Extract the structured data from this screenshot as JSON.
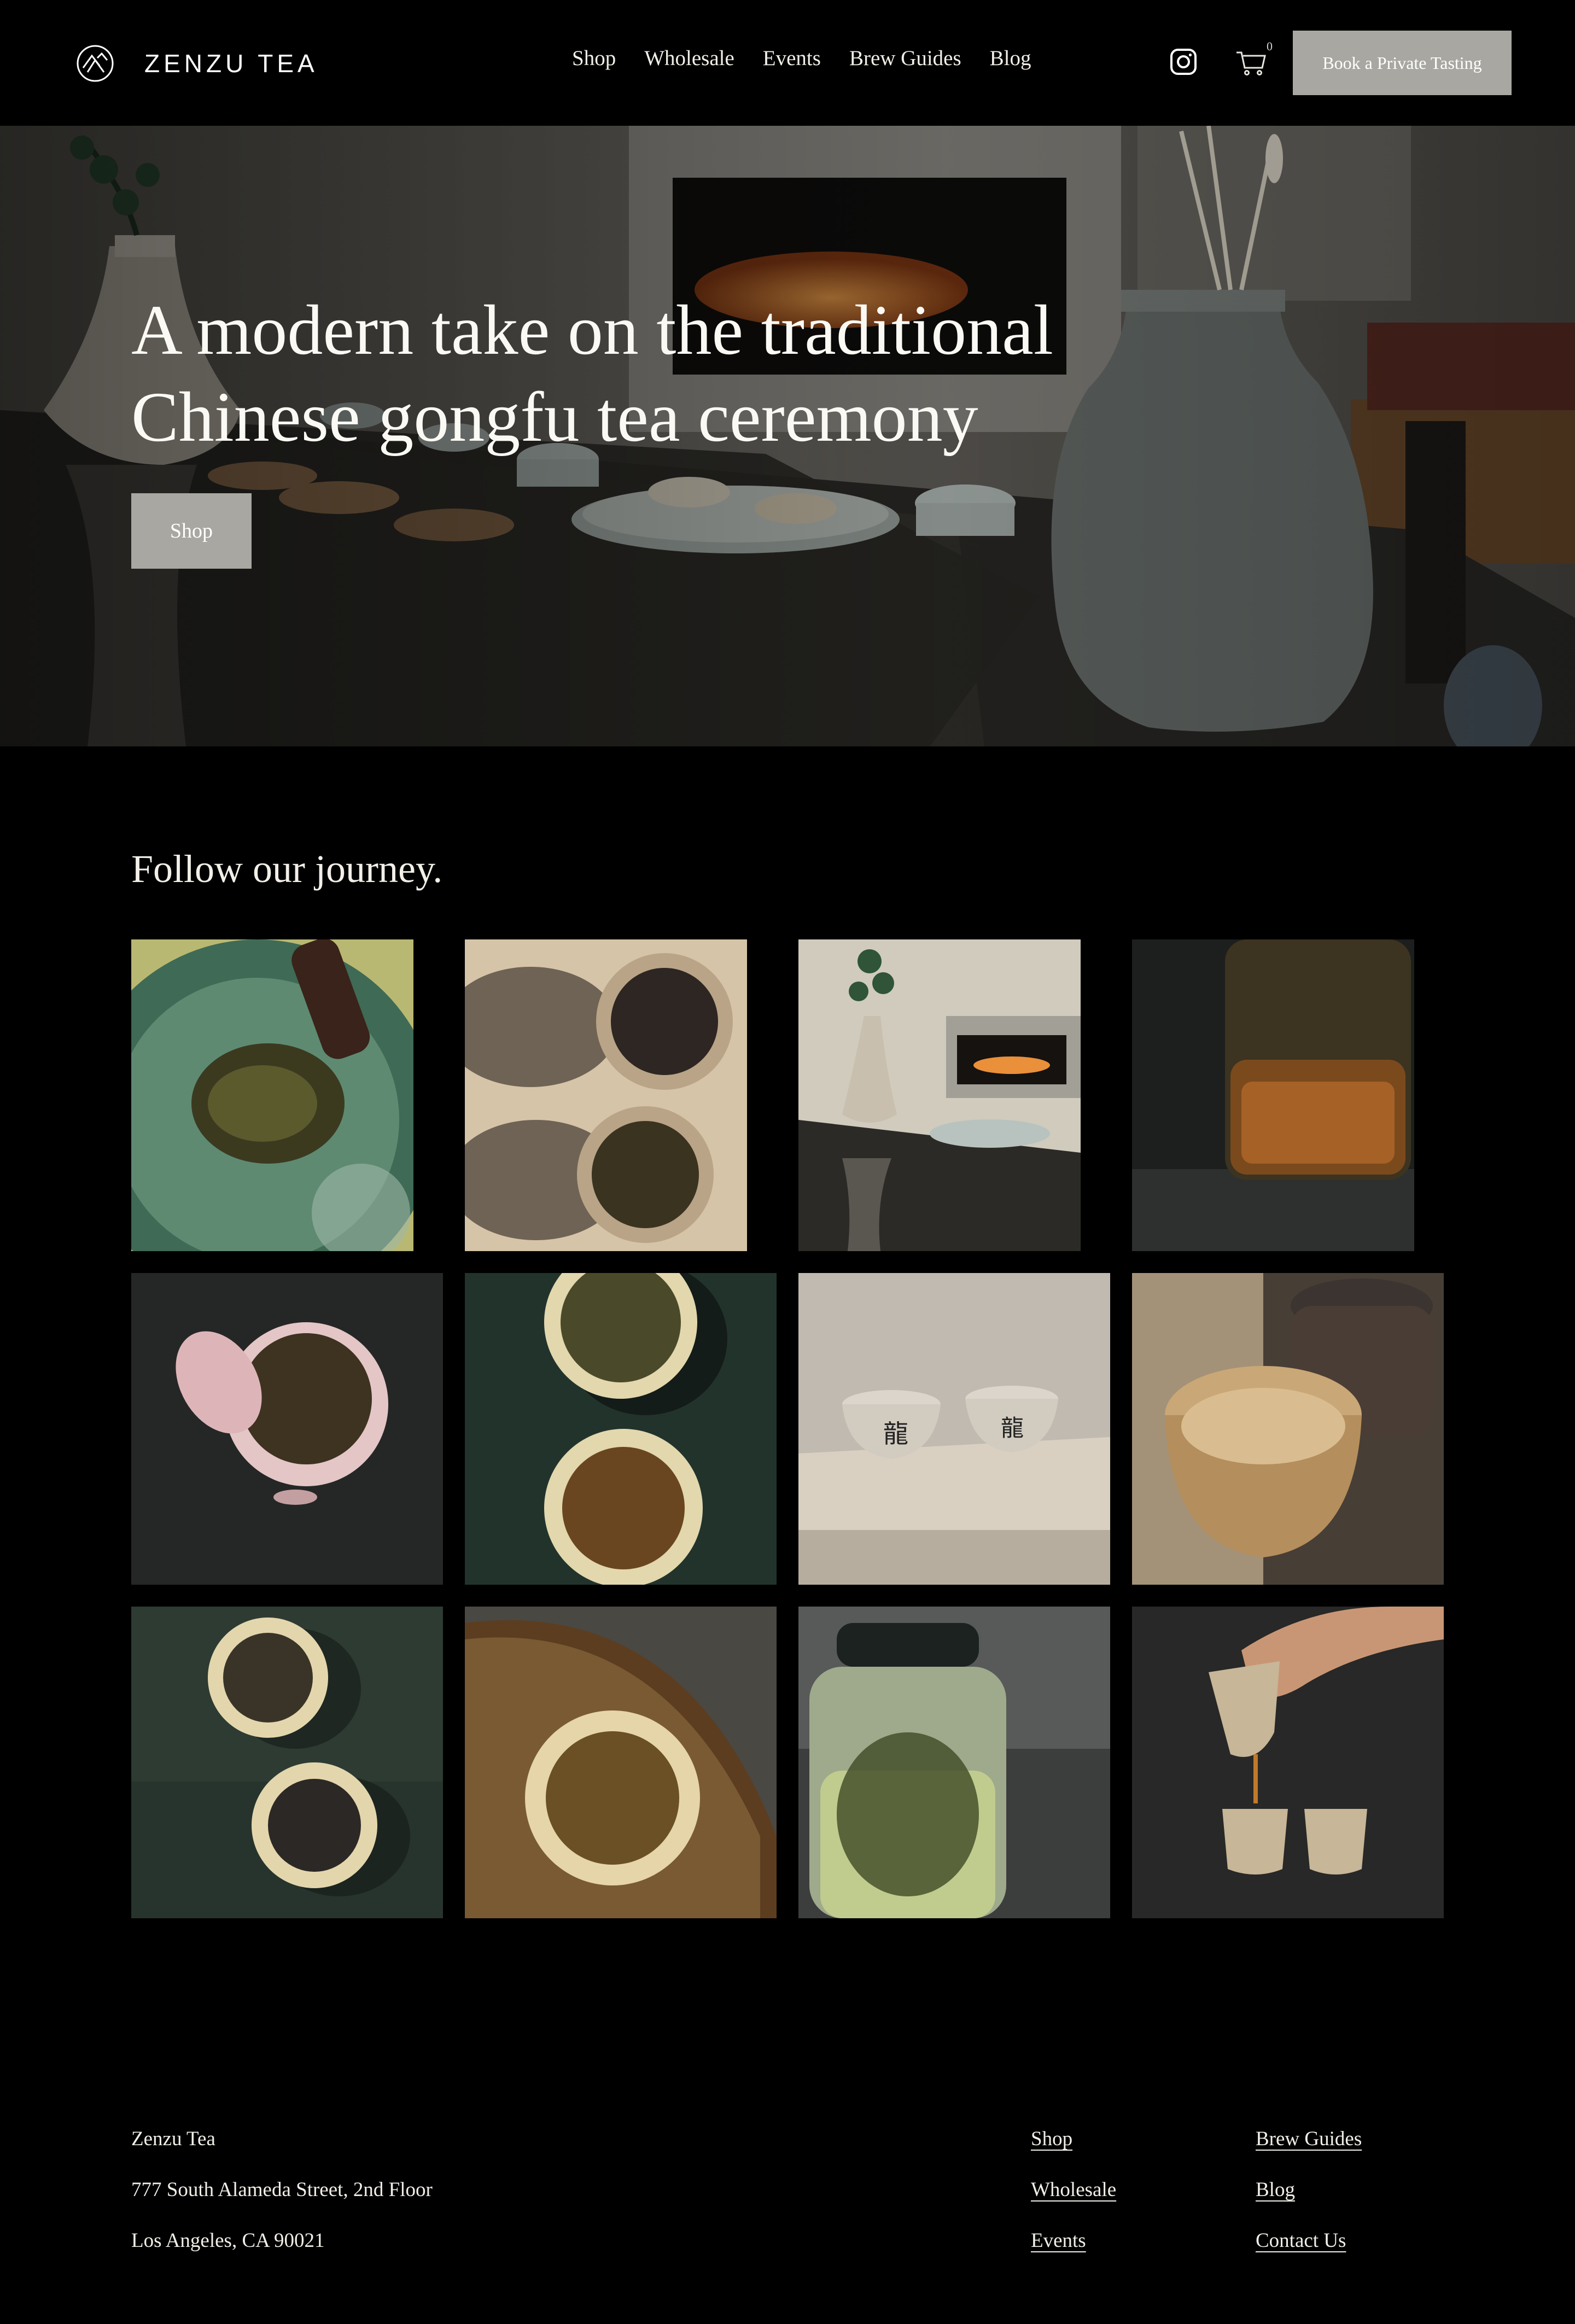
{
  "header": {
    "brand_name": "ZENZU TEA",
    "nav": [
      "Shop",
      "Wholesale",
      "Events",
      "Brew Guides",
      "Blog"
    ],
    "cart_count": "0",
    "cta_label": "Book a Private Tasting"
  },
  "hero": {
    "title_line1": "A modern take on the traditional",
    "title_line2": "Chinese gongfu tea ceremony",
    "button_label": "Shop"
  },
  "journey": {
    "title": "Follow our journey."
  },
  "footer": {
    "company": "Zenzu Tea",
    "address_line1": "777 South Alameda Street, 2nd Floor",
    "address_line2": "Los Angeles, CA 90021",
    "links_col1": [
      "Shop",
      "Wholesale",
      "Events"
    ],
    "links_col2": [
      "Brew Guides",
      "Blog",
      "Contact Us"
    ]
  },
  "colors": {
    "background": "#000000",
    "button_gray": "#a8a7a1",
    "text": "#f2efe8"
  },
  "icons": [
    "zenzu-logo-icon",
    "instagram-icon",
    "cart-icon"
  ]
}
